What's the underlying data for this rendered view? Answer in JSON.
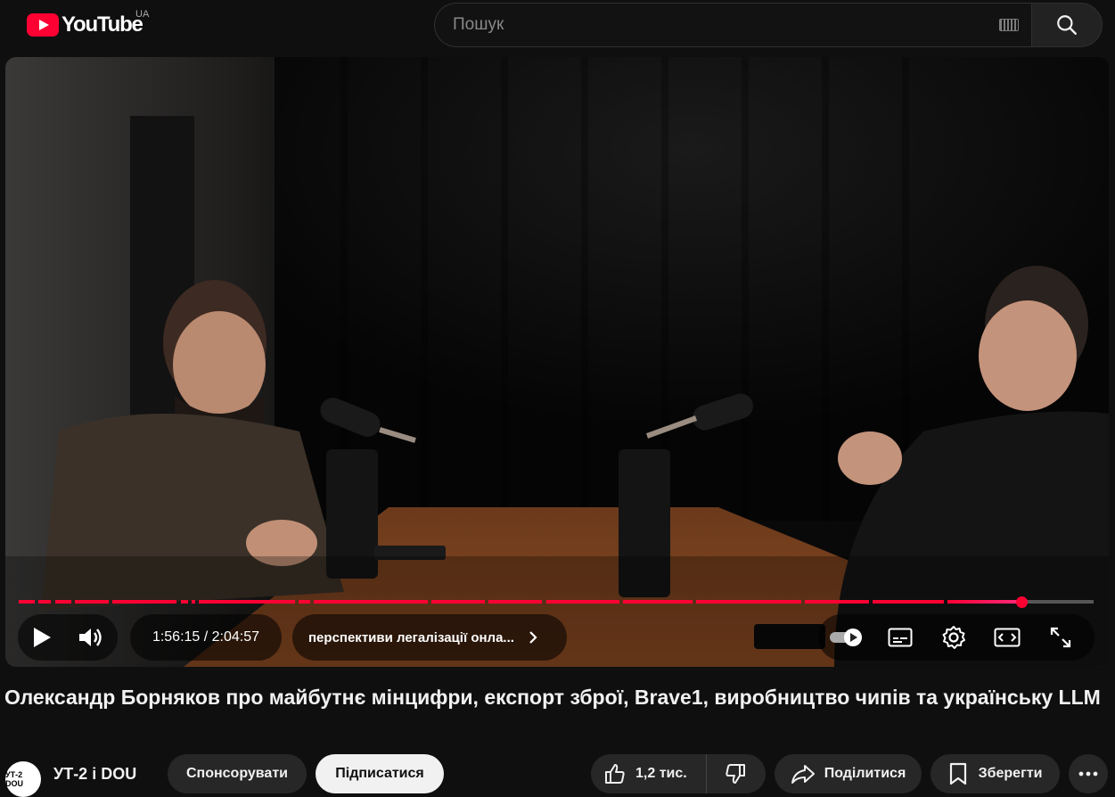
{
  "header": {
    "logo_text": "YouTube",
    "country": "UA",
    "search_placeholder": "Пошук"
  },
  "player": {
    "progress_fraction": 0.9325,
    "time_current": "1:56:15",
    "time_total": "2:04:57",
    "time_display": "1:56:15 / 2:04:57",
    "chapter": "перспективи легалізації онла...",
    "autoplay_on": true,
    "accent_color": "#ff0033"
  },
  "video": {
    "title": "Олександр Борняков про майбутнє мінцифри, експорт зброї, Brave1, виробництво чипів та українську LLM"
  },
  "channel": {
    "avatar_text": "УТ-2 DOU",
    "name": "УТ-2 і DOU"
  },
  "actions": {
    "sponsor": "Спонсорувати",
    "subscribe": "Підписатися",
    "likes": "1,2 тис.",
    "share": "Поділитися",
    "save": "Зберегти"
  }
}
